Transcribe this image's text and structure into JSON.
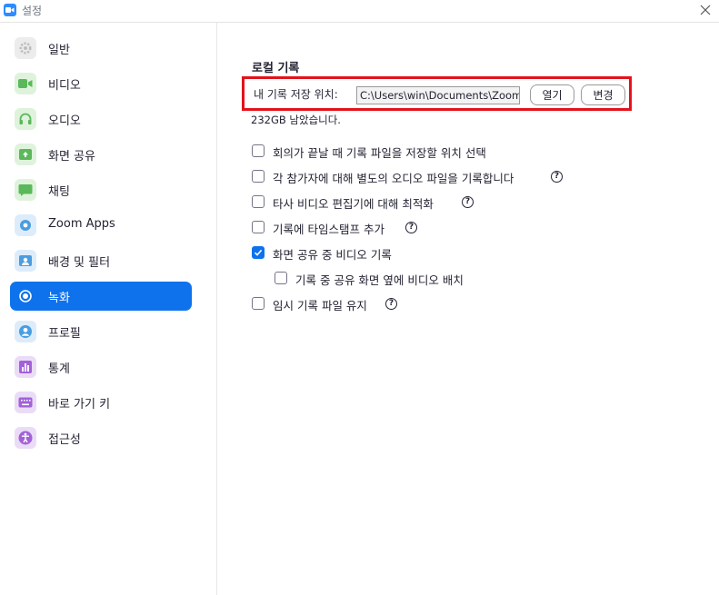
{
  "window": {
    "title": "설정"
  },
  "sidebar": {
    "items": [
      {
        "label": "일반",
        "icon": "gear-icon",
        "color": "#e8e8e8"
      },
      {
        "label": "비디오",
        "icon": "video-icon",
        "color": "#e6f7e6"
      },
      {
        "label": "오디오",
        "icon": "headphones-icon",
        "color": "#e6f7e6"
      },
      {
        "label": "화면 공유",
        "icon": "share-screen-icon",
        "color": "#e6f7e6"
      },
      {
        "label": "채팅",
        "icon": "chat-icon",
        "color": "#e6f7e6"
      },
      {
        "label": "Zoom Apps",
        "icon": "apps-icon",
        "color": "#e6f2ff"
      },
      {
        "label": "배경 및 필터",
        "icon": "background-icon",
        "color": "#e6f2ff"
      },
      {
        "label": "녹화",
        "icon": "record-icon",
        "color": "#0e72ed",
        "active": true
      },
      {
        "label": "프로필",
        "icon": "profile-icon",
        "color": "#e6f2ff"
      },
      {
        "label": "통계",
        "icon": "statistics-icon",
        "color": "#f3e6ff"
      },
      {
        "label": "바로 가기 키",
        "icon": "keyboard-icon",
        "color": "#f3e6ff"
      },
      {
        "label": "접근성",
        "icon": "accessibility-icon",
        "color": "#f3e6ff"
      }
    ]
  },
  "recording": {
    "section_title": "로컬 기록",
    "location_label": "내 기록 저장 위치:",
    "location_value": "C:\\Users\\win\\Documents\\Zoom",
    "open_label": "열기",
    "change_label": "변경",
    "free_space": "232GB 남았습니다.",
    "options": [
      {
        "label": "회의가 끝날 때 기록 파일을 저장할 위치 선택",
        "checked": false,
        "help": false,
        "indent": false
      },
      {
        "label": "각 참가자에 대해 별도의 오디오 파일을 기록합니다",
        "checked": false,
        "help": true,
        "indent": false
      },
      {
        "label": "타사 비디오 편집기에 대해 최적화",
        "checked": false,
        "help": true,
        "indent": false
      },
      {
        "label": "기록에 타임스탬프 추가",
        "checked": false,
        "help": true,
        "indent": false
      },
      {
        "label": "화면 공유 중 비디오 기록",
        "checked": true,
        "help": false,
        "indent": false
      },
      {
        "label": "기록 중 공유 화면 옆에 비디오 배치",
        "checked": false,
        "help": false,
        "indent": true
      },
      {
        "label": "임시 기록 파일 유지",
        "checked": false,
        "help": true,
        "indent": false
      }
    ],
    "help_glyph": "?"
  },
  "colors": {
    "accent": "#0e72ed",
    "highlight_border": "#e3131b"
  }
}
